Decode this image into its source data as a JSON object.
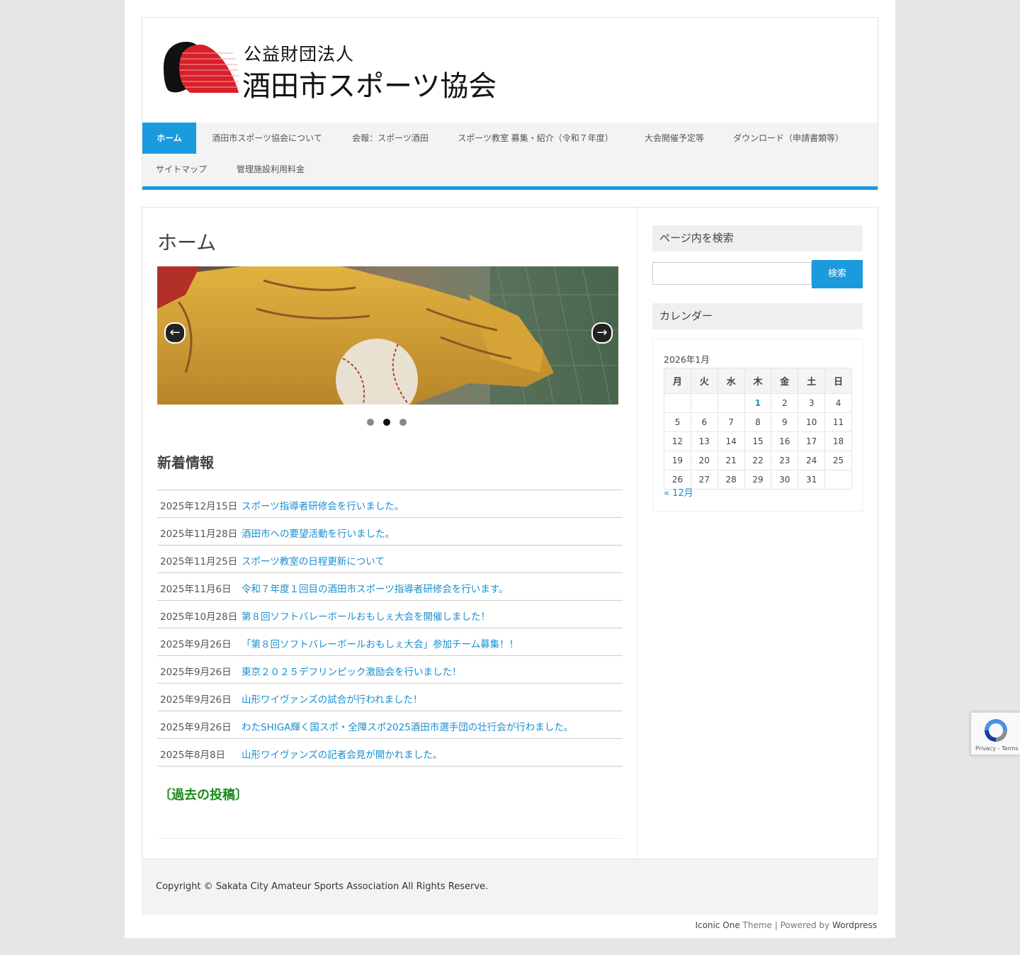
{
  "header": {
    "logo_small": "公益財団法人",
    "logo_big": "酒田市スポーツ協会"
  },
  "nav": {
    "items": [
      {
        "label": "ホーム",
        "active": true
      },
      {
        "label": "酒田市スポーツ協会について"
      },
      {
        "label": "会報：スポーツ酒田"
      },
      {
        "label": "スポーツ教室 募集・紹介（令和７年度）"
      },
      {
        "label": "大会開催予定等"
      },
      {
        "label": "ダウンロード（申請書類等）"
      },
      {
        "label": "サイトマップ"
      },
      {
        "label": "管理施設利用料金"
      }
    ]
  },
  "main": {
    "page_title": "ホーム",
    "slider": {
      "prev_glyph": "←",
      "next_glyph": "→",
      "active_dot": 2,
      "dot_count": 3
    },
    "news_heading": "新着情報",
    "news": [
      {
        "date": "2025年12月15日",
        "title": "スポーツ指導者研修会を行いました。"
      },
      {
        "date": "2025年11月28日",
        "title": "酒田市への要望活動を行いました。"
      },
      {
        "date": "2025年11月25日",
        "title": "スポーツ教室の日程更新について"
      },
      {
        "date": "2025年11月6日",
        "title": "令和７年度１回目の酒田市スポーツ指導者研修会を行います。"
      },
      {
        "date": "2025年10月28日",
        "title": "第８回ソフトバレーボールおもしぇ大会を開催しました！"
      },
      {
        "date": "2025年9月26日",
        "title": "「第８回ソフトバレーボールおもしぇ大会」参加チーム募集！！"
      },
      {
        "date": "2025年9月26日",
        "title": "東京２０２５デフリンピック激励会を行いました！"
      },
      {
        "date": "2025年9月26日",
        "title": "山形ワイヴァンズの試合が行われました！"
      },
      {
        "date": "2025年9月26日",
        "title": "わたSHIGA輝く国スポ・全障スポ2025酒田市選手団の壮行会が行わました。"
      },
      {
        "date": "2025年8月8日",
        "title": "山形ワイヴァンズの記者会見が開かれました。"
      }
    ],
    "past_posts": "〔過去の投稿〕"
  },
  "sidebar": {
    "search_title": "ページ内を検索",
    "search_button": "検索",
    "search_value": "",
    "calendar_title": "カレンダー",
    "calendar": {
      "caption": "2026年1月",
      "weekdays": [
        "月",
        "火",
        "水",
        "木",
        "金",
        "土",
        "日"
      ],
      "weeks": [
        [
          "",
          "",
          "",
          "1",
          "2",
          "3",
          "4"
        ],
        [
          "5",
          "6",
          "7",
          "8",
          "9",
          "10",
          "11"
        ],
        [
          "12",
          "13",
          "14",
          "15",
          "16",
          "17",
          "18"
        ],
        [
          "19",
          "20",
          "21",
          "22",
          "23",
          "24",
          "25"
        ],
        [
          "26",
          "27",
          "28",
          "29",
          "30",
          "31",
          ""
        ]
      ],
      "linked_day": "1",
      "prev_link": "« 12月"
    }
  },
  "footer": {
    "copyright": "Copyright © Sakata City Amateur Sports Association All Rights Reserve.",
    "credit_theme_name": "Iconic One",
    "credit_theme_word": " Theme",
    "credit_sep": " | Powered by ",
    "credit_wp": "Wordpress"
  },
  "recaptcha": {
    "text": "Privacy - Terms"
  },
  "colors": {
    "accent": "#1a9bdd",
    "link": "#1a8fd0",
    "past_posts": "#1a8a1a",
    "logo_red": "#d8202a"
  }
}
